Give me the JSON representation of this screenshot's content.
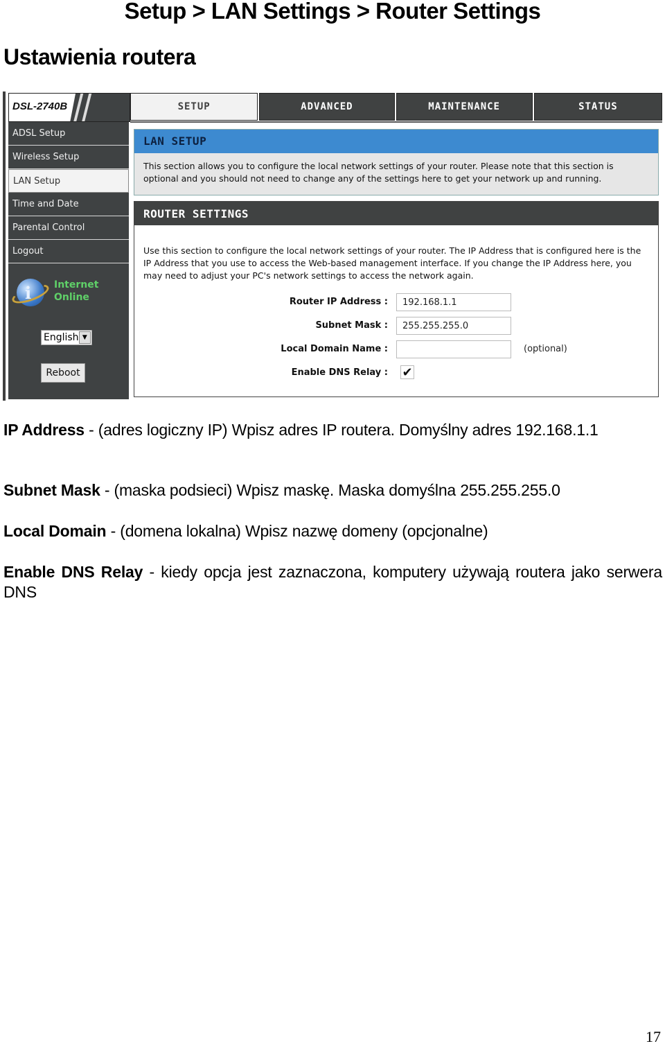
{
  "document": {
    "title": "Setup > LAN Settings > Router Settings",
    "subtitle": "Ustawienia routera",
    "page_number": "17"
  },
  "router_ui": {
    "model": "DSL-2740B",
    "top_tabs": [
      {
        "label": "SETUP",
        "active": true
      },
      {
        "label": "ADVANCED",
        "active": false
      },
      {
        "label": "MAINTENANCE",
        "active": false
      },
      {
        "label": "STATUS",
        "active": false
      }
    ],
    "sidebar": {
      "items": [
        {
          "label": "ADSL Setup",
          "active": false
        },
        {
          "label": "Wireless Setup",
          "active": false
        },
        {
          "label": "LAN Setup",
          "active": true
        },
        {
          "label": "Time and Date",
          "active": false
        },
        {
          "label": "Parental Control",
          "active": false
        },
        {
          "label": "Logout",
          "active": false
        }
      ],
      "status_line1": "Internet",
      "status_line2": "Online",
      "language": "English",
      "reboot_label": "Reboot"
    },
    "lan_setup": {
      "header": "LAN SETUP",
      "description": "This section allows you to configure the local network settings of your router. Please note that this section is optional and you should not need to change any of the settings here to get your network up and running."
    },
    "router_settings": {
      "header": "ROUTER SETTINGS",
      "description": "Use this section to configure the local network settings of your router. The IP Address that is configured here is the IP Address that you use to access the Web-based management interface. If you change the IP Address here, you may need to adjust your PC's network settings to access the network again.",
      "fields": {
        "router_ip_label": "Router IP Address :",
        "router_ip_value": "192.168.1.1",
        "subnet_mask_label": "Subnet Mask :",
        "subnet_mask_value": "255.255.255.0",
        "local_domain_label": "Local Domain Name :",
        "local_domain_value": "",
        "local_domain_note": "(optional)",
        "dns_relay_label": "Enable DNS Relay :",
        "dns_relay_checked": true
      }
    },
    "colors": {
      "nav_dark": "#404242",
      "lan_header_blue": "#3d8ad0",
      "status_green": "#5fd068"
    }
  },
  "explanations": [
    {
      "term": "IP Address",
      "text": " - (adres logiczny IP)  Wpisz adres IP routera. Domyślny adres 192.168.1.1"
    },
    {
      "term": "Subnet Mask",
      "text": " - (maska podsieci) Wpisz maskę. Maska domyślna 255.255.255.0"
    },
    {
      "term": "Local Domain",
      "text": " - (domena lokalna) Wpisz nazwę domeny (opcjonalne)"
    },
    {
      "term": "Enable DNS Relay",
      "text": " - kiedy opcja jest zaznaczona, komputery używają routera jako serwera DNS"
    }
  ]
}
